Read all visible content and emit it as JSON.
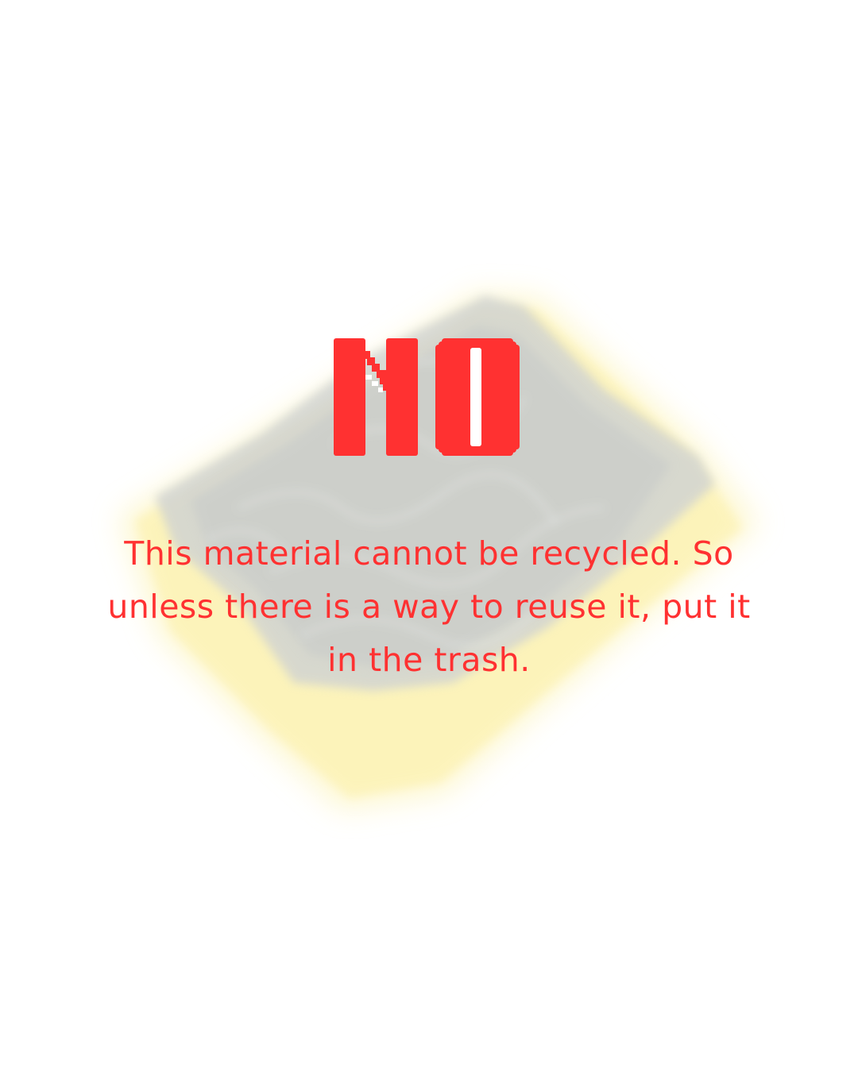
{
  "headline": "NO",
  "message": "This material cannot be recycled. So unless there is a way to reuse it, put it in the trash.",
  "illustration": "scrub-sponge",
  "colors": {
    "accent": "#ff3131",
    "background": "#ffffff",
    "sponge_foam": "#fdf6c8",
    "sponge_scourer": "#d6d8d8"
  }
}
